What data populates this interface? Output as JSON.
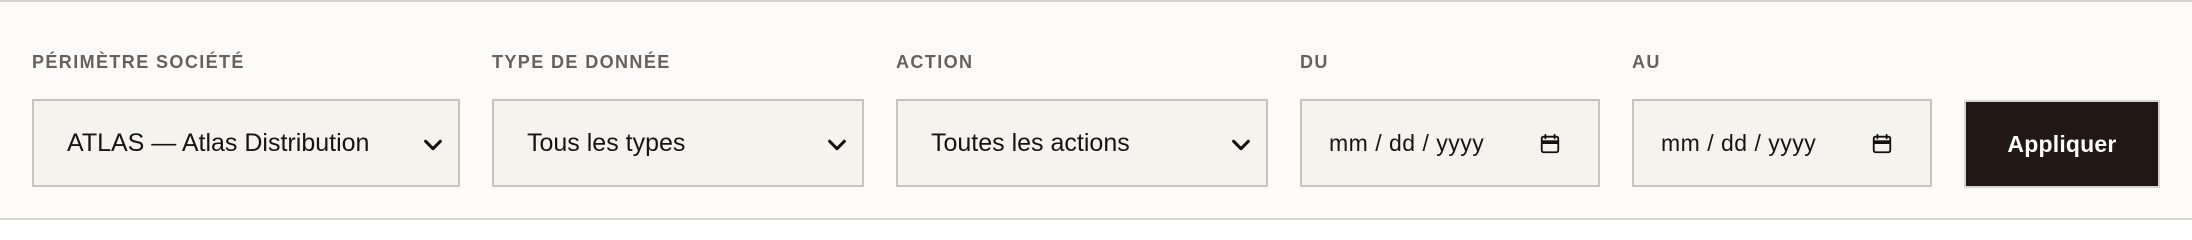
{
  "filters": {
    "company_scope": {
      "label": "PÉRIMÈTRE SOCIÉTÉ",
      "value": "ATLAS — Atlas Distribution",
      "icon": "chevron-down-icon"
    },
    "data_type": {
      "label": "TYPE DE DONNÉE",
      "value": "Tous les types",
      "icon": "chevron-down-icon"
    },
    "action": {
      "label": "ACTION",
      "value": "Toutes les actions",
      "icon": "chevron-down-icon"
    },
    "date_from": {
      "label": "DU",
      "value": "mm / dd / yyyy",
      "icon": "calendar-icon"
    },
    "date_to": {
      "label": "AU",
      "value": "mm / dd / yyyy",
      "icon": "calendar-icon"
    }
  },
  "apply_button": {
    "label": "Appliquer"
  },
  "colors": {
    "panel_background": "#fcfaf8",
    "field_background": "#f5f3ee",
    "field_border": "#c8c3bd",
    "label_text": "#67615d",
    "value_text": "#151515",
    "button_background": "#211714",
    "button_text": "#ffffff"
  }
}
